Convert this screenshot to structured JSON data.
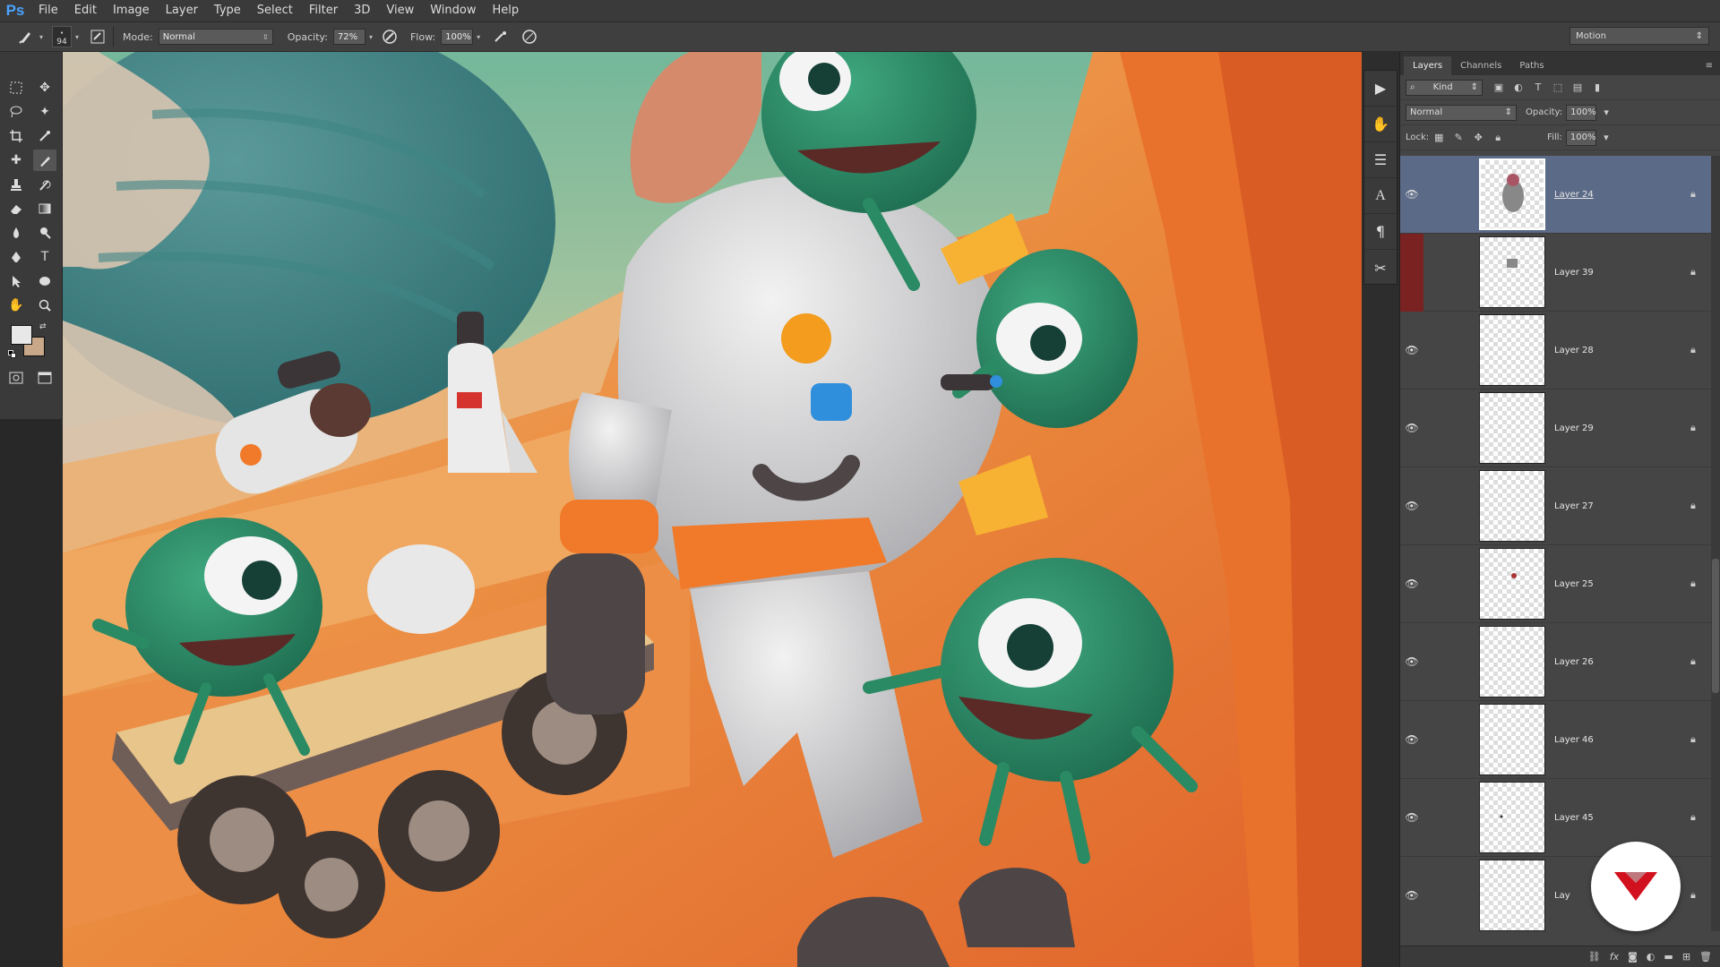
{
  "app": {
    "logo_text": "Ps",
    "workspace": "Motion"
  },
  "menu": [
    "File",
    "Edit",
    "Image",
    "Layer",
    "Type",
    "Select",
    "Filter",
    "3D",
    "View",
    "Window",
    "Help"
  ],
  "options": {
    "brush_size": "94",
    "mode_label": "Mode:",
    "mode_value": "Normal",
    "opacity_label": "Opacity:",
    "opacity_value": "72%",
    "flow_label": "Flow:",
    "flow_value": "100%"
  },
  "layers_panel": {
    "tabs": [
      "Layers",
      "Channels",
      "Paths"
    ],
    "filter_kind": "Kind",
    "blend_mode": "Normal",
    "opacity_label": "Opacity:",
    "opacity_value": "100%",
    "lock_label": "Lock:",
    "fill_label": "Fill:",
    "fill_value": "100%",
    "layers": [
      {
        "name": "Layer 24",
        "visible": true,
        "selected": true
      },
      {
        "name": "Layer 39",
        "visible": false,
        "selected": false
      },
      {
        "name": "Layer 28",
        "visible": true,
        "selected": false
      },
      {
        "name": "Layer 29",
        "visible": true,
        "selected": false
      },
      {
        "name": "Layer 27",
        "visible": true,
        "selected": false
      },
      {
        "name": "Layer 25",
        "visible": true,
        "selected": false
      },
      {
        "name": "Layer 26",
        "visible": true,
        "selected": false
      },
      {
        "name": "Layer 46",
        "visible": true,
        "selected": false
      },
      {
        "name": "Layer 45",
        "visible": true,
        "selected": false
      },
      {
        "name": "Lay",
        "visible": true,
        "selected": false
      }
    ]
  },
  "colors": {
    "foreground": "#e8e8e8",
    "background": "#c8a888",
    "selection": "#5b6a86",
    "badge_accent": "#d2111e"
  }
}
